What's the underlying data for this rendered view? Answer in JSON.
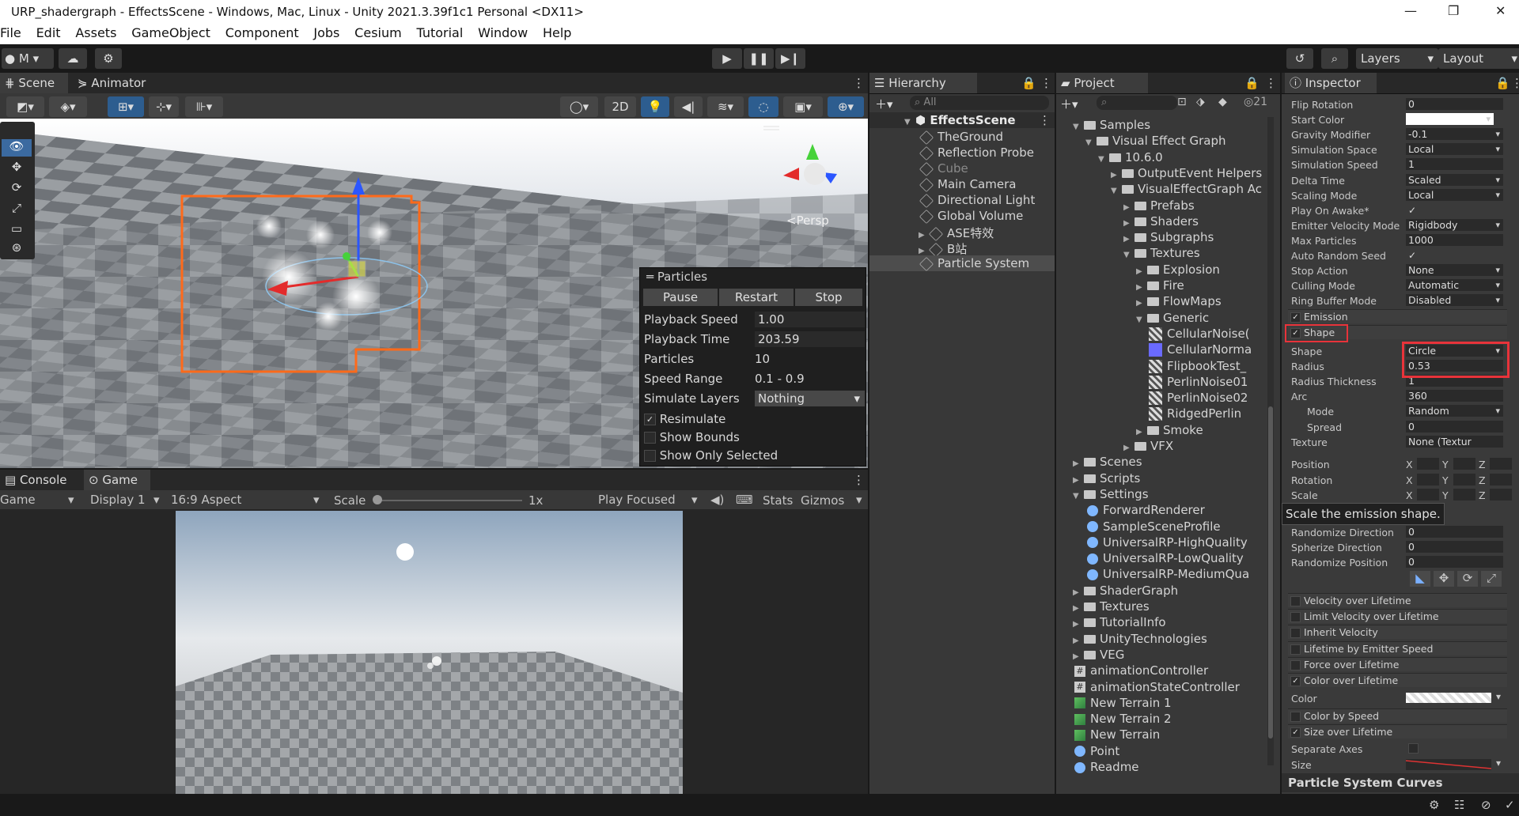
{
  "window": {
    "title": "URP_shadergraph - EffectsScene - Windows, Mac, Linux - Unity 2021.3.39f1c1 Personal <DX11>"
  },
  "menu": [
    "File",
    "Edit",
    "Assets",
    "GameObject",
    "Component",
    "Jobs",
    "Cesium",
    "Tutorial",
    "Window",
    "Help"
  ],
  "toolbar": {
    "account": "M",
    "layers": "Layers",
    "layout": "Layout"
  },
  "scene": {
    "tabs": [
      "Scene",
      "Animator"
    ],
    "btn_2d": "2D",
    "persp": "<Persp",
    "particles": {
      "title": "Particles",
      "buttons": [
        "Pause",
        "Restart",
        "Stop"
      ],
      "rows": [
        {
          "label": "Playback Speed",
          "value": "1.00"
        },
        {
          "label": "Playback Time",
          "value": "203.59"
        },
        {
          "label": "Particles",
          "value": "10"
        },
        {
          "label": "Speed Range",
          "value": "0.1 - 0.9"
        },
        {
          "label": "Simulate Layers",
          "value": "Nothing"
        }
      ],
      "checks": [
        {
          "label": "Resimulate",
          "checked": true
        },
        {
          "label": "Show Bounds",
          "checked": false
        },
        {
          "label": "Show Only Selected",
          "checked": false
        }
      ]
    }
  },
  "game": {
    "tabs": [
      "Console",
      "Game"
    ],
    "controls": {
      "mode": "Game",
      "display": "Display 1",
      "aspect": "16:9 Aspect",
      "scale_label": "Scale",
      "scale_value": "1x",
      "play": "Play Focused",
      "stats": "Stats",
      "gizmos": "Gizmos"
    }
  },
  "hierarchy": {
    "title": "Hierarchy",
    "search": "All",
    "scene": "EffectsScene",
    "items": [
      "TheGround",
      "Reflection Probe",
      "Cube",
      "Main Camera",
      "Directional Light",
      "Global Volume",
      "ASE特效",
      "B站",
      "Particle System"
    ]
  },
  "project": {
    "title": "Project",
    "count": "21",
    "items": [
      {
        "label": "Samples",
        "indent": 0,
        "type": "folder"
      },
      {
        "label": "Visual Effect Graph",
        "indent": 1,
        "type": "folder"
      },
      {
        "label": "10.6.0",
        "indent": 2,
        "type": "folder"
      },
      {
        "label": "OutputEvent Helpers",
        "indent": 3,
        "type": "folder"
      },
      {
        "label": "VisualEffectGraph Ac",
        "indent": 3,
        "type": "folder"
      },
      {
        "label": "Prefabs",
        "indent": 4,
        "type": "folder"
      },
      {
        "label": "Shaders",
        "indent": 4,
        "type": "folder"
      },
      {
        "label": "Subgraphs",
        "indent": 4,
        "type": "folder"
      },
      {
        "label": "Textures",
        "indent": 4,
        "type": "folder"
      },
      {
        "label": "Explosion",
        "indent": 5,
        "type": "folder"
      },
      {
        "label": "Fire",
        "indent": 5,
        "type": "folder"
      },
      {
        "label": "FlowMaps",
        "indent": 5,
        "type": "folder"
      },
      {
        "label": "Generic",
        "indent": 5,
        "type": "folder"
      },
      {
        "label": "CellularNoise(",
        "indent": 6,
        "type": "tex"
      },
      {
        "label": "CellularNorma",
        "indent": 6,
        "type": "tex"
      },
      {
        "label": "FlipbookTest_",
        "indent": 6,
        "type": "tex"
      },
      {
        "label": "PerlinNoise01",
        "indent": 6,
        "type": "tex"
      },
      {
        "label": "PerlinNoise02",
        "indent": 6,
        "type": "tex"
      },
      {
        "label": "RidgedPerlin",
        "indent": 6,
        "type": "tex"
      },
      {
        "label": "Smoke",
        "indent": 5,
        "type": "folder"
      },
      {
        "label": "VFX",
        "indent": 4,
        "type": "folder"
      },
      {
        "label": "Scenes",
        "indent": 0,
        "type": "folder"
      },
      {
        "label": "Scripts",
        "indent": 0,
        "type": "folder"
      },
      {
        "label": "Settings",
        "indent": 0,
        "type": "folder"
      },
      {
        "label": "ForwardRenderer",
        "indent": 1,
        "type": "asset"
      },
      {
        "label": "SampleSceneProfile",
        "indent": 1,
        "type": "asset"
      },
      {
        "label": "UniversalRP-HighQuality",
        "indent": 1,
        "type": "asset"
      },
      {
        "label": "UniversalRP-LowQuality",
        "indent": 1,
        "type": "asset"
      },
      {
        "label": "UniversalRP-MediumQua",
        "indent": 1,
        "type": "asset"
      },
      {
        "label": "ShaderGraph",
        "indent": 0,
        "type": "folder"
      },
      {
        "label": "Textures",
        "indent": 0,
        "type": "folder"
      },
      {
        "label": "TutorialInfo",
        "indent": 0,
        "type": "folder"
      },
      {
        "label": "UnityTechnologies",
        "indent": 0,
        "type": "folder"
      },
      {
        "label": "VEG",
        "indent": 0,
        "type": "folder"
      },
      {
        "label": "animationController",
        "indent": 0,
        "type": "script"
      },
      {
        "label": "animationStateController",
        "indent": 0,
        "type": "script"
      },
      {
        "label": "New Terrain 1",
        "indent": 0,
        "type": "terrain"
      },
      {
        "label": "New Terrain 2",
        "indent": 0,
        "type": "terrain"
      },
      {
        "label": "New Terrain",
        "indent": 0,
        "type": "terrain"
      },
      {
        "label": "Point",
        "indent": 0,
        "type": "asset"
      },
      {
        "label": "Readme",
        "indent": 0,
        "type": "asset"
      }
    ]
  },
  "inspector": {
    "title": "Inspector",
    "main_rows": [
      {
        "label": "Flip Rotation",
        "value": "0",
        "dropdown": false
      },
      {
        "label": "Start Color",
        "value": "",
        "dropdown": true,
        "swatch": true
      },
      {
        "label": "Gravity Modifier",
        "value": "-0.1",
        "dropdown": true
      },
      {
        "label": "Simulation Space",
        "value": "Local",
        "dropdown": true
      },
      {
        "label": "Simulation Speed",
        "value": "1",
        "dropdown": false
      },
      {
        "label": "Delta Time",
        "value": "Scaled",
        "dropdown": true
      },
      {
        "label": "Scaling Mode",
        "value": "Local",
        "dropdown": true
      },
      {
        "label": "Play On Awake*",
        "value": "✓",
        "dropdown": false,
        "check": true
      },
      {
        "label": "Emitter Velocity Mode",
        "value": "Rigidbody",
        "dropdown": true
      },
      {
        "label": "Max Particles",
        "value": "1000",
        "dropdown": false
      },
      {
        "label": "Auto Random Seed",
        "value": "✓",
        "dropdown": false,
        "check": true
      },
      {
        "label": "Stop Action",
        "value": "None",
        "dropdown": true
      },
      {
        "label": "Culling Mode",
        "value": "Automatic",
        "dropdown": true
      },
      {
        "label": "Ring Buffer Mode",
        "value": "Disabled",
        "dropdown": true
      }
    ],
    "emission": "Emission",
    "shape_module": "Shape",
    "shape_rows": [
      {
        "label": "Shape",
        "value": "Circle",
        "dropdown": true
      },
      {
        "label": "Radius",
        "value": "0.53",
        "dropdown": false
      },
      {
        "label": "Radius Thickness",
        "value": "1",
        "dropdown": false
      },
      {
        "label": "Arc",
        "value": "360",
        "dropdown": false
      },
      {
        "label": "Mode",
        "value": "Random",
        "dropdown": true,
        "indent": true
      },
      {
        "label": "Spread",
        "value": "0",
        "dropdown": false,
        "indent": true
      },
      {
        "label": "Texture",
        "value": "None (Textur",
        "dropdown": false
      }
    ],
    "xyz_rows": [
      "Position",
      "Rotation",
      "Scale"
    ],
    "axis": [
      "X",
      "Y",
      "Z"
    ],
    "tooltip": "Scale the emission shape.",
    "rand_rows": [
      {
        "label": "Randomize Direction",
        "value": "0"
      },
      {
        "label": "Spherize Direction",
        "value": "0"
      },
      {
        "label": "Randomize Position",
        "value": "0"
      }
    ],
    "modules": [
      {
        "label": "Velocity over Lifetime",
        "checked": false
      },
      {
        "label": "Limit Velocity over Lifetime",
        "checked": false
      },
      {
        "label": "Inherit Velocity",
        "checked": false
      },
      {
        "label": "Lifetime by Emitter Speed",
        "checked": false
      },
      {
        "label": "Force over Lifetime",
        "checked": false
      },
      {
        "label": "Color over Lifetime",
        "checked": true
      }
    ],
    "color_label": "Color",
    "modules2": [
      {
        "label": "Color by Speed",
        "checked": false
      },
      {
        "label": "Size over Lifetime",
        "checked": true
      }
    ],
    "separate_axes": "Separate Axes",
    "size_label": "Size",
    "curves_title": "Particle System Curves"
  },
  "colors": {
    "highlight": "#e8333a",
    "selection_orange": "#ff6a1a",
    "accent_blue": "#4a90d9"
  }
}
